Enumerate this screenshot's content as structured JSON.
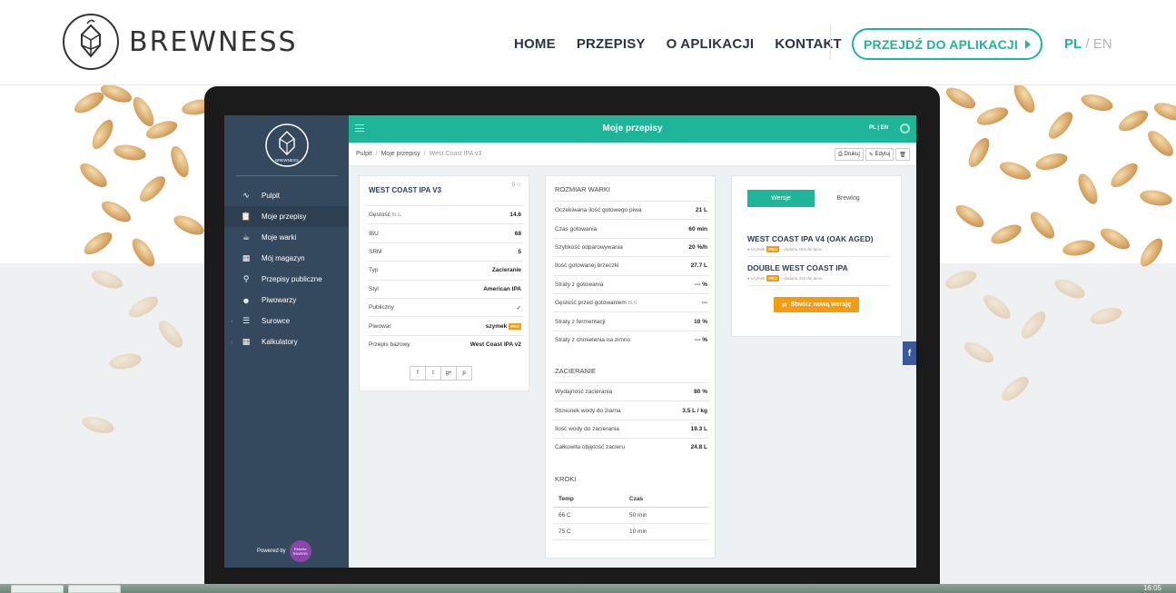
{
  "site": {
    "brand": "BREWNESS",
    "nav": [
      "HOME",
      "PRZEPISY",
      "O APLIKACJI",
      "KONTAKT"
    ],
    "cta": "PRZEJDŹ DO APLIKACJI",
    "lang_active": "PL",
    "lang_sep": " / ",
    "lang_other": "EN"
  },
  "app": {
    "title": "Moje przepisy",
    "lang": "PL | EN",
    "sidebar_logo_text": "BREWNESS",
    "menu": [
      {
        "label": "Pulpit",
        "icon": "rss-icon"
      },
      {
        "label": "Moje przepisy",
        "icon": "clipboard-icon",
        "active": true
      },
      {
        "label": "Moje warki",
        "icon": "beer-icon"
      },
      {
        "label": "Mój magazyn",
        "icon": "warehouse-icon"
      },
      {
        "label": "Przepisy publiczne",
        "icon": "search-icon"
      },
      {
        "label": "Piwowarzy",
        "icon": "users-icon"
      },
      {
        "label": "Surowce",
        "icon": "layers-icon"
      },
      {
        "label": "Kalkulatory",
        "icon": "calculator-icon"
      }
    ],
    "powered_by": "Powered by",
    "powered_badge": "Rebelia RAVENS",
    "breadcrumb": [
      "Pulpit",
      "Moje przepisy",
      "West Coast IPA v3"
    ],
    "actions": {
      "print": "Drukuj",
      "edit": "Edytuj"
    }
  },
  "recipe": {
    "title": "WEST COAST IPA V3",
    "stars": "0 ☆",
    "rows": [
      {
        "label": "Gęstość",
        "unit": "BLG",
        "value": "14.6"
      },
      {
        "label": "IBU",
        "value": "68"
      },
      {
        "label": "SRM",
        "value": "5"
      },
      {
        "label": "Typ",
        "value": "Zacieranie"
      },
      {
        "label": "Styl",
        "value": "American IPA"
      },
      {
        "label": "Publiczny",
        "value": "✓"
      },
      {
        "label": "Piwowar",
        "value": "szymek",
        "badge": "PRO"
      },
      {
        "label": "Przepis bazowy",
        "value": "West Coast IPA v2"
      }
    ],
    "share": [
      "f",
      "t",
      "g+",
      "p"
    ]
  },
  "batch": {
    "title": "ROZMIAR WARKI",
    "rows": [
      {
        "label": "Oczekiwana ilość gotowego piwa",
        "value": "21 L"
      },
      {
        "label": "Czas gotowania",
        "value": "60 min"
      },
      {
        "label": "Szybkość odparowywania",
        "value": "20 %/h"
      },
      {
        "label": "Ilość gotowanej brzeczki",
        "value": "27.7 L"
      },
      {
        "label": "Straty z gotowania",
        "value": "--- %"
      },
      {
        "label": "Gęstość przed gotowaniem",
        "unit": "BLG",
        "value": "---"
      },
      {
        "label": "Straty z fermentacji",
        "value": "10 %"
      },
      {
        "label": "Straty z chmielenia na zimno",
        "value": "--- %"
      }
    ],
    "mash_title": "ZACIERANIE",
    "mash_rows": [
      {
        "label": "Wydajność zacierania",
        "value": "80 %"
      },
      {
        "label": "Stosunek wody do ziarna",
        "value": "3.5 L / kg"
      },
      {
        "label": "Ilość wody do zacierania",
        "value": "19.3 L"
      },
      {
        "label": "Całkowita objętość zacieru",
        "value": "24.8 L"
      }
    ],
    "steps_title": "KROKI",
    "steps_head": [
      "Temp",
      "Czas"
    ],
    "steps": [
      [
        "66 C",
        "50 min"
      ],
      [
        "75 C",
        "10 min"
      ]
    ]
  },
  "versions": {
    "tab_active": "Wersje",
    "tab_other": "Brewlog",
    "items": [
      {
        "title": "WEST COAST IPA V4 (OAK AGED)",
        "author": "szymek",
        "badge": "PRO",
        "added": "dodano 263 dni temu"
      },
      {
        "title": "DOUBLE WEST COAST IPA",
        "author": "szymek",
        "badge": "PRO",
        "added": "dodano 315 dni temu"
      }
    ],
    "new_button": "Stwórz nową wersję"
  },
  "fb": "f",
  "clock": "16:05",
  "colors": {
    "accent": "#1fb598",
    "sidebar": "#34495e",
    "orange": "#f39c12",
    "facebook": "#3b5998"
  }
}
